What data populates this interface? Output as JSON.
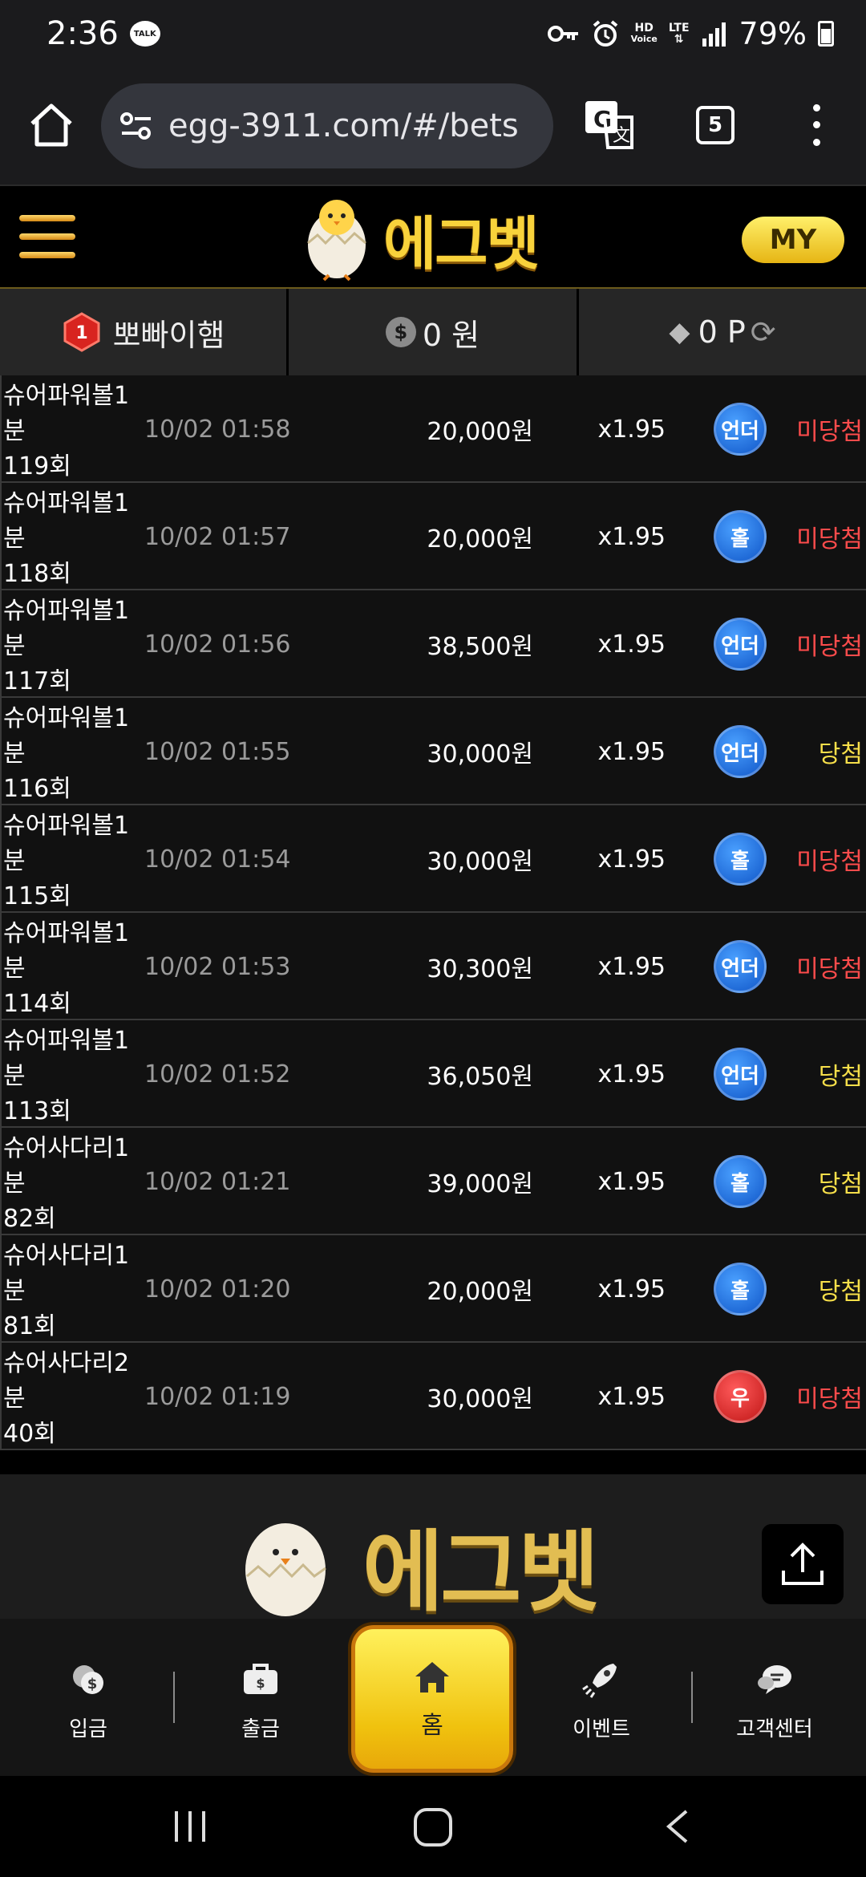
{
  "status": {
    "time": "2:36",
    "talk": "TALK",
    "hd": "HD",
    "voice": "Voice",
    "lte": "LTE",
    "battery": "79%"
  },
  "browser": {
    "url": "egg-3911.com/#/bets",
    "tab_count": "5"
  },
  "site": {
    "logo_text": "에그벳",
    "my_label": "MY"
  },
  "user": {
    "level": "1",
    "name": "뽀빠이햄",
    "money": "0 원",
    "points": "0 P"
  },
  "bets": [
    {
      "game": "슈어파워볼1\n분\n119회",
      "time": "10/02 01:58",
      "amount": "20,000원",
      "odds": "x1.95",
      "pick": "언더",
      "pick_color": "blue",
      "result": "미당첨",
      "status": "lose"
    },
    {
      "game": "슈어파워볼1\n분\n118회",
      "time": "10/02 01:57",
      "amount": "20,000원",
      "odds": "x1.95",
      "pick": "홀",
      "pick_color": "blue",
      "result": "미당첨",
      "status": "lose"
    },
    {
      "game": "슈어파워볼1\n분\n117회",
      "time": "10/02 01:56",
      "amount": "38,500원",
      "odds": "x1.95",
      "pick": "언더",
      "pick_color": "blue",
      "result": "미당첨",
      "status": "lose"
    },
    {
      "game": "슈어파워볼1\n분\n116회",
      "time": "10/02 01:55",
      "amount": "30,000원",
      "odds": "x1.95",
      "pick": "언더",
      "pick_color": "blue",
      "result": "당첨",
      "status": "win"
    },
    {
      "game": "슈어파워볼1\n분\n115회",
      "time": "10/02 01:54",
      "amount": "30,000원",
      "odds": "x1.95",
      "pick": "홀",
      "pick_color": "blue",
      "result": "미당첨",
      "status": "lose"
    },
    {
      "game": "슈어파워볼1\n분\n114회",
      "time": "10/02 01:53",
      "amount": "30,300원",
      "odds": "x1.95",
      "pick": "언더",
      "pick_color": "blue",
      "result": "미당첨",
      "status": "lose"
    },
    {
      "game": "슈어파워볼1\n분\n113회",
      "time": "10/02 01:52",
      "amount": "36,050원",
      "odds": "x1.95",
      "pick": "언더",
      "pick_color": "blue",
      "result": "당첨",
      "status": "win"
    },
    {
      "game": "슈어사다리1\n분\n82회",
      "time": "10/02 01:21",
      "amount": "39,000원",
      "odds": "x1.95",
      "pick": "홀",
      "pick_color": "blue",
      "result": "당첨",
      "status": "win"
    },
    {
      "game": "슈어사다리1\n분\n81회",
      "time": "10/02 01:20",
      "amount": "20,000원",
      "odds": "x1.95",
      "pick": "홀",
      "pick_color": "blue",
      "result": "당첨",
      "status": "win"
    },
    {
      "game": "슈어사다리2\n분\n40회",
      "time": "10/02 01:19",
      "amount": "30,000원",
      "odds": "x1.95",
      "pick": "우",
      "pick_color": "red",
      "result": "미당첨",
      "status": "lose"
    }
  ],
  "footer": {
    "logo_text": "에그벳"
  },
  "nav": {
    "deposit": "입금",
    "withdraw": "출금",
    "home": "홈",
    "event": "이벤트",
    "support": "고객센터"
  },
  "colors": {
    "accent": "#f0c20e",
    "win": "#f7df4a",
    "lose": "#ff4c4c",
    "pick_blue": "#1056c8",
    "pick_red": "#c01616"
  }
}
